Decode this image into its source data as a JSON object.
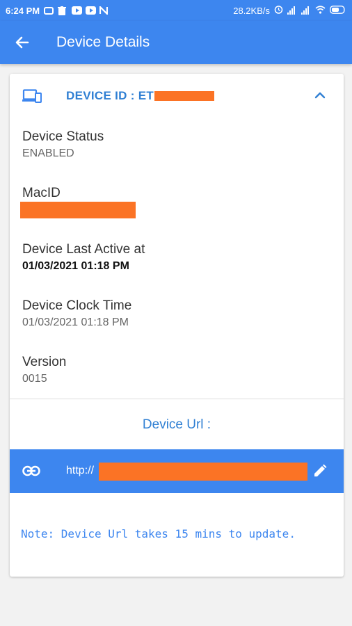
{
  "status_bar": {
    "time": "6:24 PM",
    "speed": "28.2KB/s",
    "icons": [
      "message-icon",
      "trash-icon",
      "youtube-icon",
      "youtube-icon",
      "n-icon",
      "alarm-icon",
      "signal-icon",
      "signal-icon",
      "wifi-icon",
      "battery-icon"
    ]
  },
  "app_bar": {
    "title": "Device Details",
    "back_icon": "arrow-left-icon"
  },
  "device": {
    "id_label": "DEVICE ID : ET",
    "fields": {
      "status": {
        "label": "Device Status",
        "value": "ENABLED"
      },
      "mac": {
        "label": "MacID",
        "value": ""
      },
      "last_active": {
        "label": "Device Last Active at",
        "value": "01/03/2021 01:18 PM"
      },
      "clock_time": {
        "label": "Device Clock Time",
        "value": "01/03/2021 01:18 PM"
      },
      "version": {
        "label": "Version",
        "value": "0015"
      }
    }
  },
  "url_section": {
    "heading": "Device Url :",
    "url_prefix": "http://",
    "note": "Note: Device Url takes 15 mins to update."
  },
  "colors": {
    "primary": "#3d86ef",
    "accent_text": "#2f7fd3",
    "redaction": "#fb7325"
  }
}
